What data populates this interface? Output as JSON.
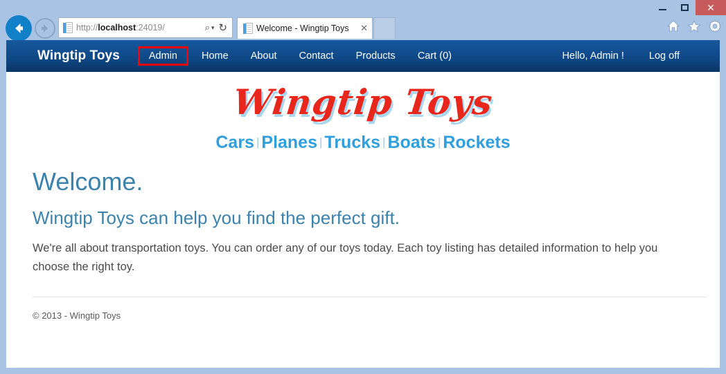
{
  "window": {
    "minimize_label": "–",
    "maximize_label": "☐",
    "close_label": "✕",
    "frame_color": "#a8c3e4",
    "close_color": "#c75b5b"
  },
  "browser": {
    "back_icon": "back-arrow-icon",
    "forward_icon": "forward-arrow-icon",
    "address": {
      "url_scheme": "http://",
      "url_host": "localhost",
      "url_rest": ":24019/",
      "search_icon": "⌕",
      "dropdown_icon": "▾",
      "refresh_icon": "↻"
    },
    "tab": {
      "title": "Welcome - Wingtip Toys",
      "close_label": "✕"
    },
    "toolbar_icons": [
      "home-icon",
      "favorites-star-icon",
      "settings-gear-icon"
    ]
  },
  "navbar": {
    "brand": "Wingtip Toys",
    "links": [
      {
        "label": "Admin",
        "highlighted": true
      },
      {
        "label": "Home",
        "highlighted": false
      },
      {
        "label": "About",
        "highlighted": false
      },
      {
        "label": "Contact",
        "highlighted": false
      },
      {
        "label": "Products",
        "highlighted": false
      },
      {
        "label": "Cart (0)",
        "highlighted": false
      }
    ],
    "right_links": [
      {
        "label": "Hello, Admin !"
      },
      {
        "label": "Log off"
      }
    ],
    "highlight_color": "#ff0000",
    "gradient_top": "#17589e",
    "gradient_bottom": "#083562"
  },
  "logo": {
    "text": "Wingtip Toys",
    "color": "#e8261c",
    "shadow_color": "#a9d6ef"
  },
  "categories": {
    "separator": "|",
    "color": "#2f9fdd",
    "items": [
      {
        "label": "Cars"
      },
      {
        "label": "Planes"
      },
      {
        "label": "Trucks"
      },
      {
        "label": "Boats"
      },
      {
        "label": "Rockets"
      }
    ]
  },
  "main": {
    "headline": "Welcome.",
    "subhead": "Wingtip Toys can help you find the perfect gift.",
    "body": "We're all about transportation toys. You can order any of our toys today. Each toy listing has detailed information to help you choose the right toy.",
    "heading_color": "#3b82ac"
  },
  "footer": {
    "text": "© 2013 - Wingtip Toys"
  }
}
